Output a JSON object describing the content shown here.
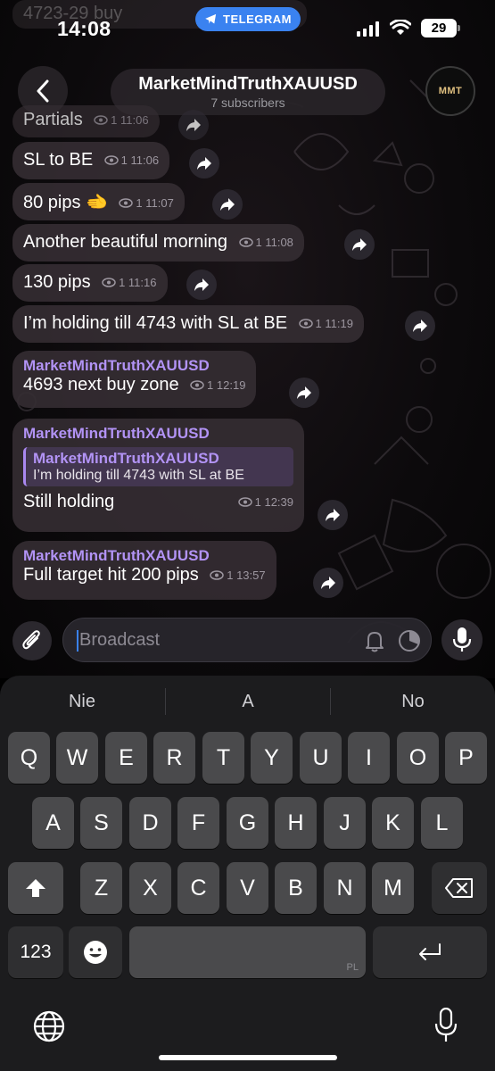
{
  "status_bar": {
    "time": "14:08",
    "app_pill": "TELEGRAM",
    "battery": "29"
  },
  "ghost": {
    "top_text": "4723-29 buy"
  },
  "header": {
    "title": "MarketMindTruthXAUUSD",
    "subtitle": "7 subscribers",
    "avatar_text": "MMT"
  },
  "messages": [
    {
      "text": "Partials",
      "time": "1 11:06"
    },
    {
      "text": "SL to BE",
      "time": "1 11:06"
    },
    {
      "text": "80 pips 🫲",
      "time": "1 11:07"
    },
    {
      "text": "Another beautiful morning",
      "time": "1 11:08"
    },
    {
      "text": "130 pips",
      "time": "1 11:16"
    },
    {
      "text": "I’m holding till 4743 with SL at BE",
      "time": "1 11:19"
    },
    {
      "sender": "MarketMindTruthXAUUSD",
      "text": "4693 next buy zone",
      "time": "1 12:19"
    },
    {
      "sender": "MarketMindTruthXAUUSD",
      "reply_name": "MarketMindTruthXAUUSD",
      "reply_text": "I’m holding till 4743 with SL at BE",
      "text": "Still holding",
      "time": "1 12:39"
    },
    {
      "sender": "MarketMindTruthXAUUSD",
      "text": "Full target hit 200 pips",
      "time": "1 13:57"
    }
  ],
  "input": {
    "placeholder": "Broadcast"
  },
  "keyboard": {
    "suggestions": [
      "Nie",
      "A",
      "No"
    ],
    "row1": [
      "Q",
      "W",
      "E",
      "R",
      "T",
      "Y",
      "U",
      "I",
      "O",
      "P"
    ],
    "row2": [
      "A",
      "S",
      "D",
      "F",
      "G",
      "H",
      "J",
      "K",
      "L"
    ],
    "row3": [
      "Z",
      "X",
      "C",
      "V",
      "B",
      "N",
      "M"
    ],
    "numbers_key": "123",
    "space_lang": "PL"
  },
  "colors": {
    "accent": "#3a82f0",
    "sender": "#b293f5",
    "bubble": "#342c32"
  },
  "icons": [
    "telegram-icon",
    "signal-icon",
    "wifi-icon",
    "back-chevron-icon",
    "eye-icon",
    "forward-icon",
    "paperclip-icon",
    "bell-icon",
    "timer-icon",
    "microphone-icon",
    "shift-icon",
    "backspace-icon",
    "emoji-icon",
    "return-icon",
    "globe-icon"
  ]
}
